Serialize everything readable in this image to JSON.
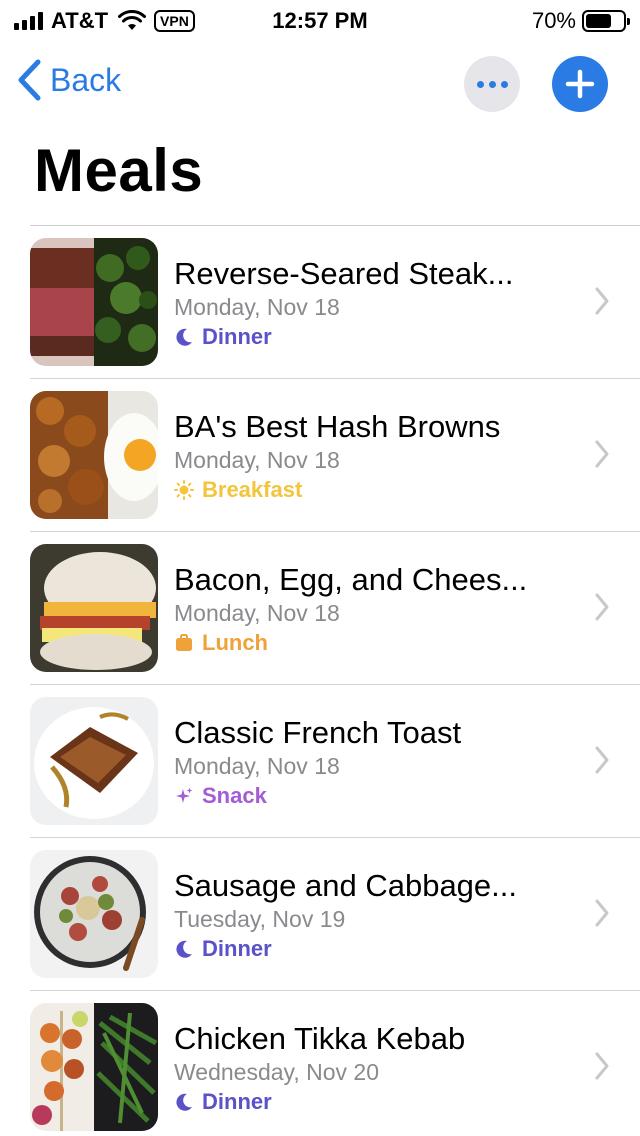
{
  "status_bar": {
    "carrier": "AT&T",
    "vpn": "VPN",
    "time": "12:57 PM",
    "battery_percent": "70%",
    "battery_level": 0.7
  },
  "nav": {
    "back_label": "Back"
  },
  "page_title": "Meals",
  "colors": {
    "accent": "#2a7be4",
    "dinner": "#5a52c8",
    "breakfast": "#f2c53d",
    "lunch": "#f0a23a",
    "snack": "#a45bd6"
  },
  "meals": [
    {
      "title": "Reverse-Seared Steak...",
      "date": "Monday, Nov 18",
      "type": "Dinner",
      "type_icon": "moon-icon"
    },
    {
      "title": "BA's Best Hash Browns",
      "date": "Monday, Nov 18",
      "type": "Breakfast",
      "type_icon": "sun-icon"
    },
    {
      "title": "Bacon, Egg, and Chees...",
      "date": "Monday, Nov 18",
      "type": "Lunch",
      "type_icon": "lunchbox-icon"
    },
    {
      "title": "Classic French Toast",
      "date": "Monday, Nov 18",
      "type": "Snack",
      "type_icon": "sparkle-icon"
    },
    {
      "title": "Sausage and Cabbage...",
      "date": "Tuesday, Nov 19",
      "type": "Dinner",
      "type_icon": "moon-icon"
    },
    {
      "title": "Chicken Tikka Kebab",
      "date": "Wednesday, Nov 20",
      "type": "Dinner",
      "type_icon": "moon-icon"
    }
  ]
}
